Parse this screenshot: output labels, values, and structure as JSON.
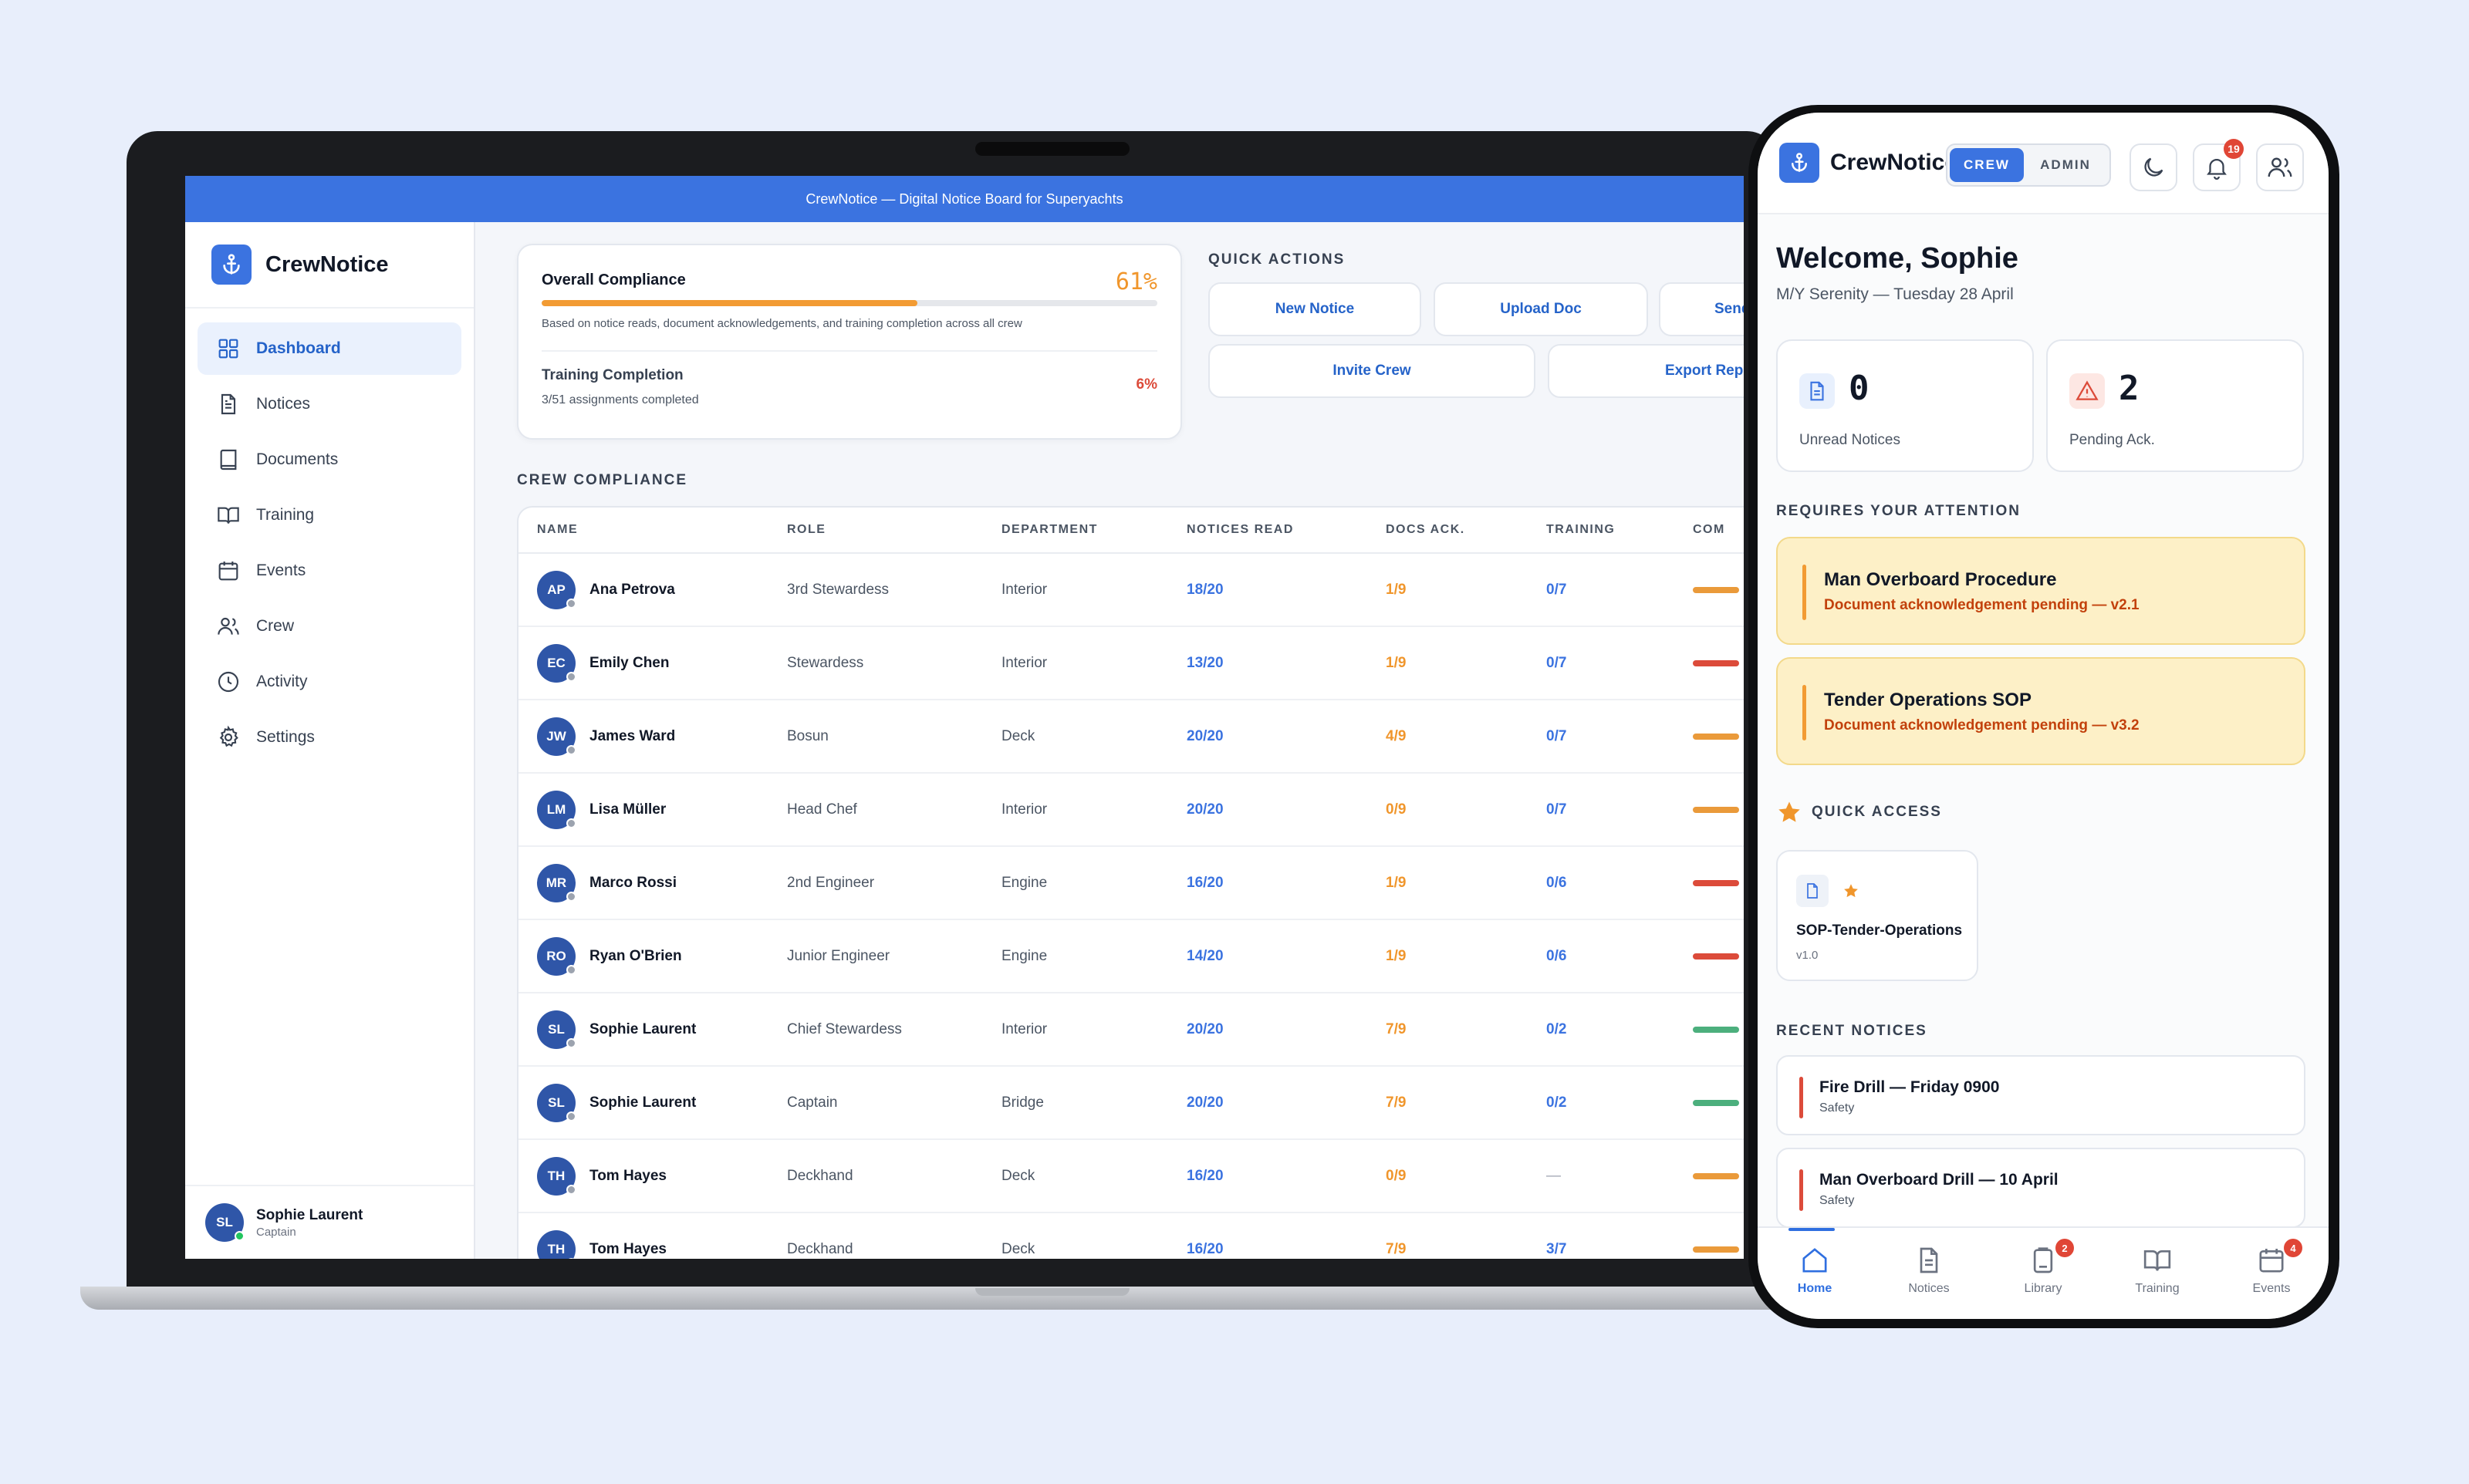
{
  "laptop": {
    "topbar_title": "CrewNotice — Digital Notice Board for Superyachts",
    "brand": "CrewNotice",
    "nav": [
      {
        "label": "Dashboard",
        "icon": "dashboard-icon",
        "active": true
      },
      {
        "label": "Notices",
        "icon": "file-icon"
      },
      {
        "label": "Documents",
        "icon": "book-icon"
      },
      {
        "label": "Training",
        "icon": "open-book-icon"
      },
      {
        "label": "Events",
        "icon": "calendar-icon"
      },
      {
        "label": "Crew",
        "icon": "users-icon"
      },
      {
        "label": "Activity",
        "icon": "clock-icon"
      },
      {
        "label": "Settings",
        "icon": "gear-icon"
      }
    ],
    "user": {
      "initials": "SL",
      "name": "Sophie Laurent",
      "role": "Captain"
    },
    "compliance": {
      "title": "Overall Compliance",
      "percent_label": "61%",
      "percent_value": 61,
      "note": "Based on notice reads, document acknowledgements, and training completion across all crew",
      "training_title": "Training Completion",
      "training_percent": "6%",
      "training_note": "3/51 assignments completed"
    },
    "quick_actions": {
      "label": "QUICK ACTIONS",
      "buttons": [
        "New Notice",
        "Upload Doc",
        "Send",
        "Invite Crew",
        "Export Repo"
      ]
    },
    "crew_section": "CREW COMPLIANCE",
    "table": {
      "headers": [
        "NAME",
        "ROLE",
        "DEPARTMENT",
        "NOTICES READ",
        "DOCS ACK.",
        "TRAINING",
        "COM"
      ],
      "rows": [
        {
          "initials": "AP",
          "name": "Ana Petrova",
          "role": "3rd Stewardess",
          "dept": "Interior",
          "notices": "18/20",
          "docs": "1/9",
          "training": "0/7",
          "status": "#ea9a3a"
        },
        {
          "initials": "EC",
          "name": "Emily Chen",
          "role": "Stewardess",
          "dept": "Interior",
          "notices": "13/20",
          "docs": "1/9",
          "training": "0/7",
          "status": "#dc4b3a"
        },
        {
          "initials": "JW",
          "name": "James Ward",
          "role": "Bosun",
          "dept": "Deck",
          "notices": "20/20",
          "docs": "4/9",
          "training": "0/7",
          "status": "#ea9a3a"
        },
        {
          "initials": "LM",
          "name": "Lisa Müller",
          "role": "Head Chef",
          "dept": "Interior",
          "notices": "20/20",
          "docs": "0/9",
          "training": "0/7",
          "status": "#ea9a3a"
        },
        {
          "initials": "MR",
          "name": "Marco Rossi",
          "role": "2nd Engineer",
          "dept": "Engine",
          "notices": "16/20",
          "docs": "1/9",
          "training": "0/6",
          "status": "#dc4b3a"
        },
        {
          "initials": "RO",
          "name": "Ryan O'Brien",
          "role": "Junior Engineer",
          "dept": "Engine",
          "notices": "14/20",
          "docs": "1/9",
          "training": "0/6",
          "status": "#dc4b3a"
        },
        {
          "initials": "SL",
          "name": "Sophie Laurent",
          "role": "Chief Stewardess",
          "dept": "Interior",
          "notices": "20/20",
          "docs": "7/9",
          "training": "0/2",
          "status": "#4caf7d"
        },
        {
          "initials": "SL",
          "name": "Sophie Laurent",
          "role": "Captain",
          "dept": "Bridge",
          "notices": "20/20",
          "docs": "7/9",
          "training": "0/2",
          "status": "#4caf7d"
        },
        {
          "initials": "TH",
          "name": "Tom Hayes",
          "role": "Deckhand",
          "dept": "Deck",
          "notices": "16/20",
          "docs": "0/9",
          "training": "—",
          "status": "#ea9a3a"
        },
        {
          "initials": "TH",
          "name": "Tom Hayes",
          "role": "Deckhand",
          "dept": "Deck",
          "notices": "16/20",
          "docs": "7/9",
          "training": "3/7",
          "status": "#ea9a3a"
        }
      ]
    }
  },
  "phone": {
    "brand": "CrewNotice",
    "toggle": {
      "on": "CREW",
      "off": "ADMIN"
    },
    "notification_count": "19",
    "welcome": "Welcome, Sophie",
    "subtitle": "M/Y Serenity — Tuesday 28 April",
    "stats": [
      {
        "value": "0",
        "label": "Unread Notices"
      },
      {
        "value": "2",
        "label": "Pending Ack."
      }
    ],
    "attention_label": "REQUIRES YOUR ATTENTION",
    "attention": [
      {
        "title": "Man Overboard Procedure",
        "sub": "Document acknowledgement pending — v2.1"
      },
      {
        "title": "Tender Operations SOP",
        "sub": "Document acknowledgement pending — v3.2"
      }
    ],
    "quick_access_label": "QUICK ACCESS",
    "quick_access": {
      "title": "SOP-Tender-Operations",
      "version": "v1.0"
    },
    "recent_label": "RECENT NOTICES",
    "recent": [
      {
        "title": "Fire Drill — Friday 0900",
        "tag": "Safety"
      },
      {
        "title": "Man Overboard Drill — 10 April",
        "tag": "Safety"
      }
    ],
    "tabs": [
      {
        "label": "Home",
        "badge": ""
      },
      {
        "label": "Notices",
        "badge": ""
      },
      {
        "label": "Library",
        "badge": "2"
      },
      {
        "label": "Training",
        "badge": ""
      },
      {
        "label": "Events",
        "badge": "4"
      }
    ]
  }
}
